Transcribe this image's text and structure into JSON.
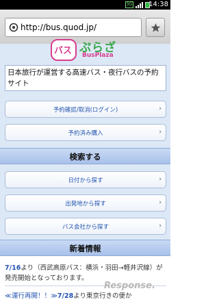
{
  "status_bar": {
    "network": "3G",
    "time": "14:38"
  },
  "browser": {
    "url": "http://bus.quod.jp/"
  },
  "logo": {
    "mark": "バス",
    "title": "ぷらざ",
    "subtitle": "BusPlaza"
  },
  "intro_text": "日本旅行が運営する高速バス・夜行バスの予約サイト",
  "top_buttons": [
    "予約確認/取消(ログイン)",
    "予約済み購入"
  ],
  "search": {
    "heading": "検索する",
    "buttons": [
      "日付から探す",
      "出発地から探す",
      "バス会社から探す"
    ]
  },
  "news": {
    "heading": "新着情報",
    "item1_date": "7/16",
    "item1_text": "より（西武高原バス：横浜・羽田→軽井沢線）が発売開始となっております。",
    "item2_prefix": "≪運行再開！！≫",
    "item2_date": "7/28",
    "item2_text": "より東京行きの便か"
  },
  "watermark": "Response."
}
